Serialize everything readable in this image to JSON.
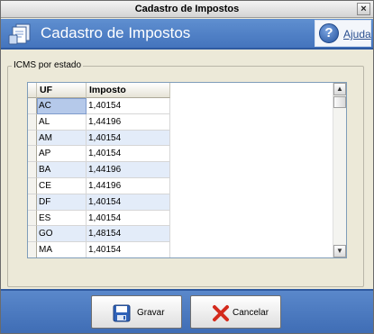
{
  "window": {
    "title": "Cadastro de Impostos"
  },
  "header": {
    "title": "Cadastro de Impostos",
    "help_label": "Ajuda",
    "help_glyph": "?"
  },
  "group": {
    "label": "ICMS por estado"
  },
  "grid": {
    "columns": [
      "UF",
      "Imposto"
    ],
    "rows": [
      {
        "uf": "AC",
        "imposto": "1,40154"
      },
      {
        "uf": "AL",
        "imposto": "1,44196"
      },
      {
        "uf": "AM",
        "imposto": "1,40154"
      },
      {
        "uf": "AP",
        "imposto": "1,40154"
      },
      {
        "uf": "BA",
        "imposto": "1,44196"
      },
      {
        "uf": "CE",
        "imposto": "1,44196"
      },
      {
        "uf": "DF",
        "imposto": "1,40154"
      },
      {
        "uf": "ES",
        "imposto": "1,40154"
      },
      {
        "uf": "GO",
        "imposto": "1,48154"
      },
      {
        "uf": "MA",
        "imposto": "1,40154"
      }
    ]
  },
  "footer": {
    "save_label": "Gravar",
    "cancel_label": "Cancelar"
  },
  "icons": {
    "header": "documents-icon",
    "help": "help-icon",
    "save": "floppy-disk-icon",
    "cancel": "red-x-icon"
  },
  "colors": {
    "header_blue": "#4f7fc6",
    "footer_blue": "#4a78bd",
    "row_alt": "#e3ecf9",
    "selected": "#b5c9ea"
  }
}
